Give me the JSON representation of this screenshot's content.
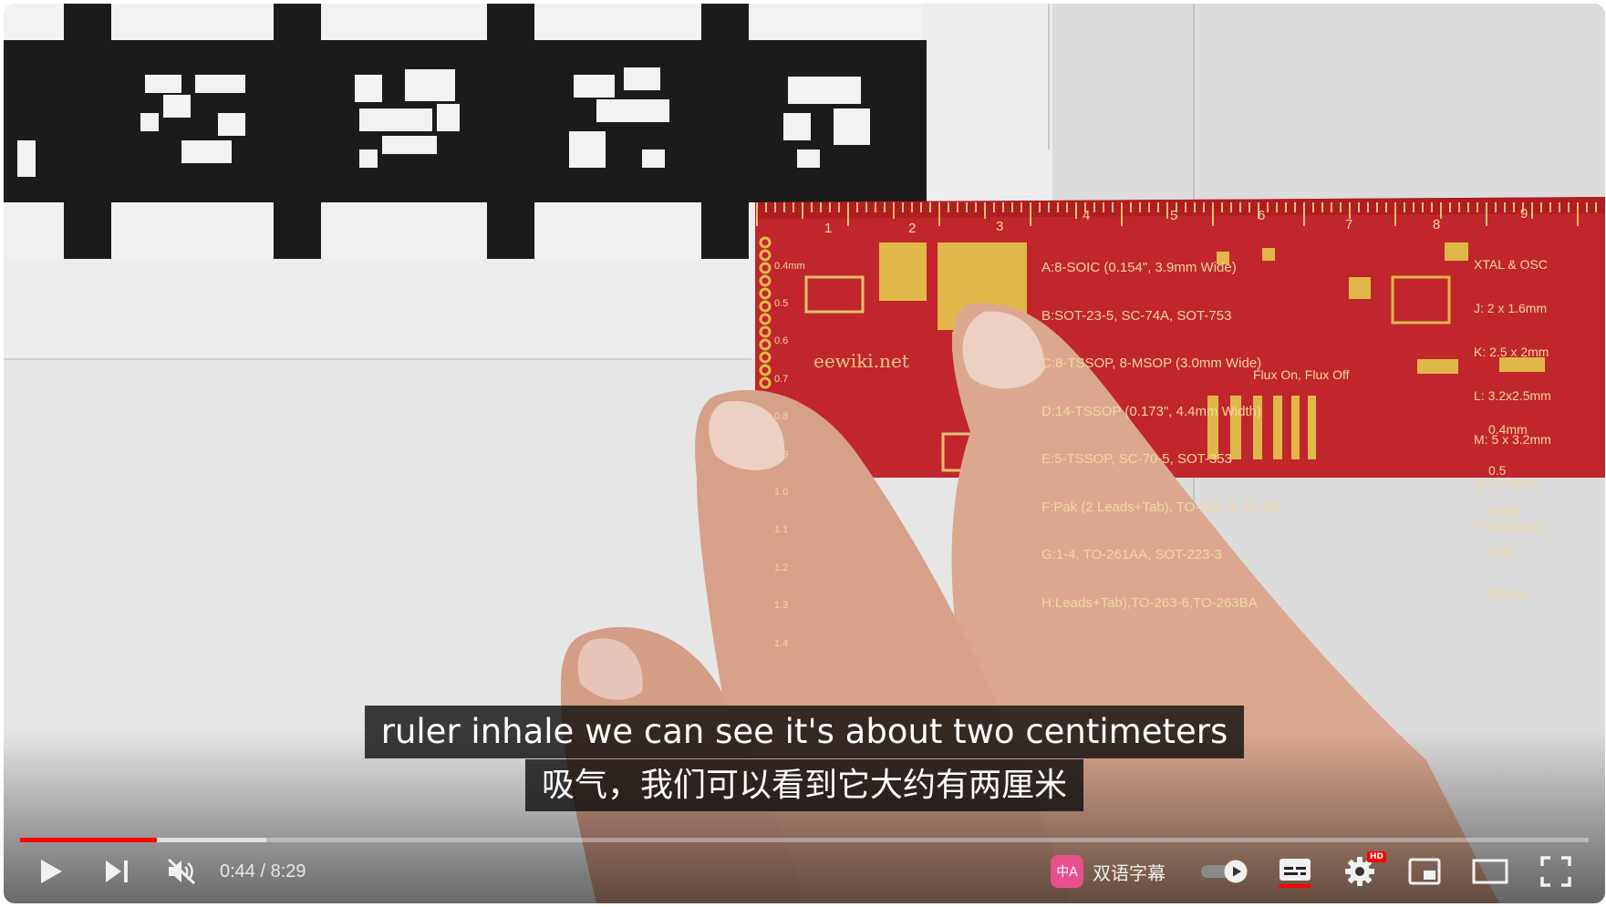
{
  "video": {
    "ruler": {
      "scale_numbers": [
        "1",
        "2",
        "3",
        "4",
        "5",
        "6",
        "7",
        "8",
        "9"
      ],
      "brand": "eewiki.net",
      "spec_lines": [
        "A:8-SOIC (0.154\", 3.9mm Wide)",
        "B:SOT-23-5, SC-74A, SOT-753",
        "C:8-TSSOP, 8-MSOP (3.0mm Wide)",
        "D:14-TSSOP (0.173\", 4.4mm Width)",
        "E:5-TSSOP, SC-70-5, SOT-353",
        "F:Pak (2 Leads+Tab), TO-252-3, SC-63",
        "G:1-4, TO-261AA, SOT-223-3",
        "H:Leads+Tab),TO-263-6,TO-263BA"
      ],
      "xtal_lines": [
        "XTAL & OSC",
        "J: 2 x 1.6mm",
        "K: 2.5 x 2mm",
        "L: 3.2x2.5mm",
        "M: 5 x 3.2mm",
        "N: 7 x 5mm",
        "P: HC49/US"
      ],
      "flux": "Flux On, Flux Off",
      "pitch_lines": [
        "0.4mm",
        "0.5",
        "0.635",
        "0.65",
        "0.8mm"
      ],
      "mm_labels": [
        "0.4mm",
        "0.5",
        "0.6",
        "0.7",
        "0.8",
        "0.9",
        "1.0",
        "1.1",
        "1.2",
        "1.3",
        "1.4"
      ]
    }
  },
  "subtitles": {
    "line_en": "ruler inhale we can see it's about two centimeters",
    "line_zh": "吸气，我们可以看到它大约有两厘米"
  },
  "player": {
    "progress": {
      "played_fraction": 0.087,
      "buffered_fraction": 0.157
    },
    "time_current": "0:44",
    "time_separator": " / ",
    "time_total": "8:29",
    "bilingual_label": "双语字幕",
    "bilingual_logo": "中A",
    "hd_badge": "HD",
    "colors": {
      "played": "#ff0000",
      "bilingual_logo": "#e8508c",
      "captions_underline": "#ff0000"
    },
    "icons": {
      "play": "play-icon",
      "next": "next-icon",
      "mute": "volume-muted-icon",
      "autoplay": "autoplay-toggle",
      "captions": "captions-icon",
      "settings": "gear-icon",
      "miniplayer": "miniplayer-icon",
      "theater": "theater-mode-icon",
      "fullscreen": "fullscreen-icon"
    }
  }
}
